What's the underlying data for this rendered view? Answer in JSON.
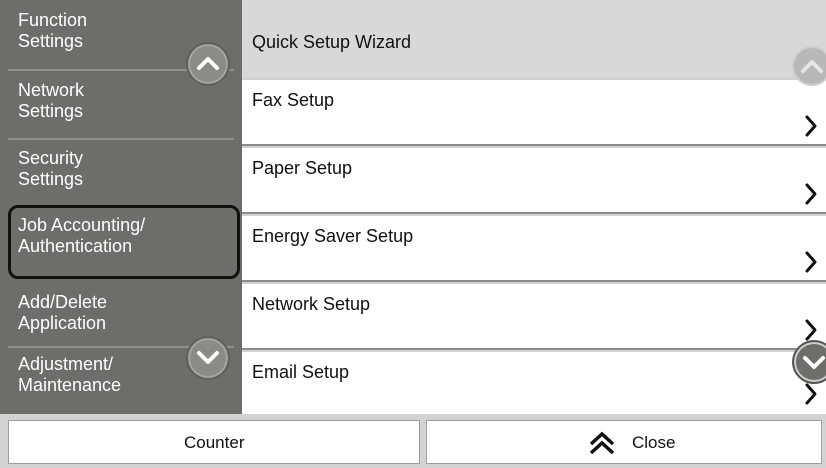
{
  "sidebar": {
    "items": [
      {
        "line1": "Function",
        "line2": "Settings"
      },
      {
        "line1": "Network",
        "line2": "Settings"
      },
      {
        "line1": "Security",
        "line2": "Settings"
      },
      {
        "line1": "Job Accounting/",
        "line2": "Authentication"
      },
      {
        "line1": "Add/Delete",
        "line2": "Application"
      },
      {
        "line1": "Adjustment/",
        "line2": "Maintenance"
      }
    ],
    "selected_index": 3
  },
  "main": {
    "header": "Quick Setup Wizard",
    "rows": [
      {
        "label": "Fax Setup"
      },
      {
        "label": "Paper Setup"
      },
      {
        "label": "Energy Saver Setup"
      },
      {
        "label": "Network Setup"
      },
      {
        "label": "Email Setup"
      }
    ]
  },
  "footer": {
    "counter_label": "Counter",
    "close_label": "Close"
  },
  "icons": {
    "sidebar_up": "chevron-up-icon",
    "sidebar_down": "chevron-down-icon",
    "list_up": "chevron-up-icon",
    "list_down": "chevron-down-icon",
    "row_arrow": "chevron-right-icon",
    "close": "double-chevron-up-icon"
  },
  "colors": {
    "sidebar_bg": "#6c6e69",
    "selected_border": "#111111",
    "row_bg": "#ffffff",
    "header_bg": "#d8d8d8"
  }
}
